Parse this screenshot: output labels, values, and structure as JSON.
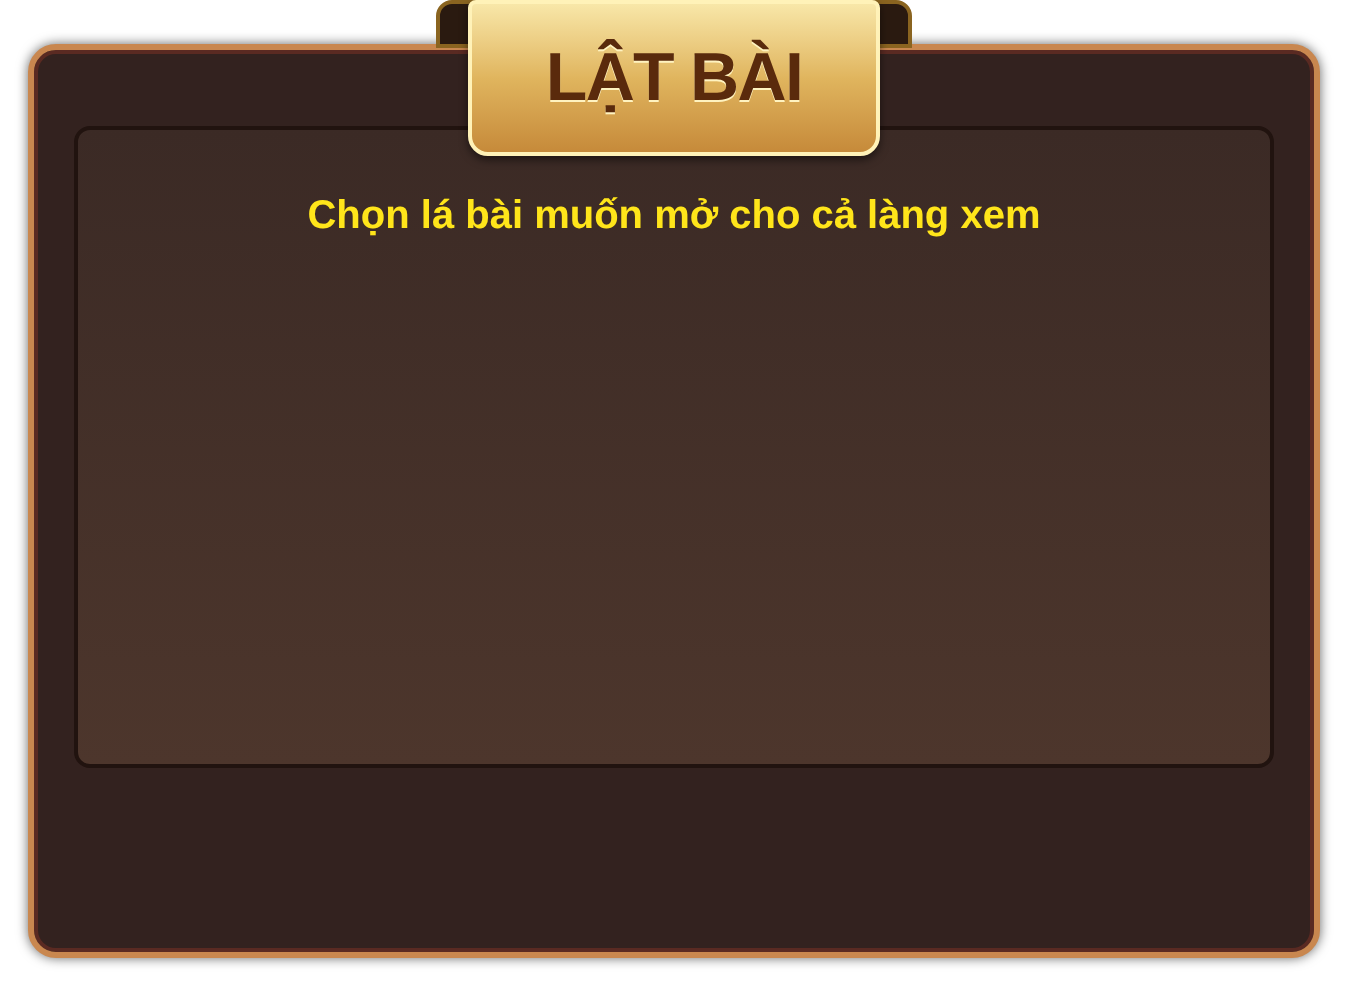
{
  "dialog": {
    "title": "LẬT BÀI",
    "instruction": "Chọn lá bài muốn mở cho cả làng xem"
  }
}
